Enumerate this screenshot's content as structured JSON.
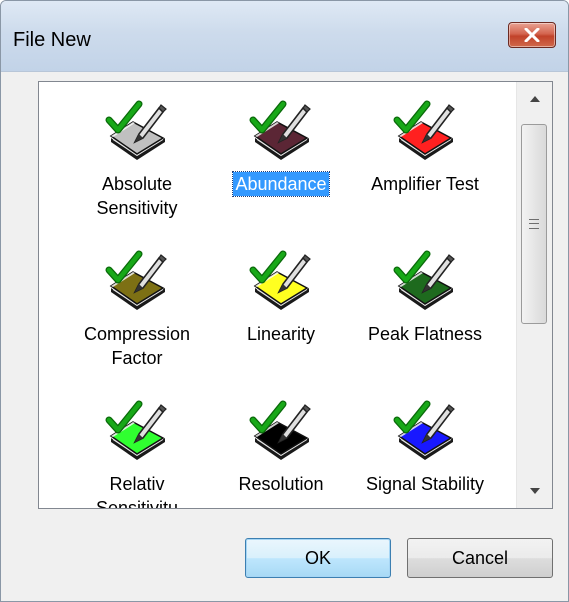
{
  "window": {
    "title": "File New",
    "close_icon": "close-icon"
  },
  "items": [
    {
      "label": "Absolute\nSensitivity",
      "color": "#c0c0c0",
      "icon": "document-check-pen-icon",
      "selected": false
    },
    {
      "label": "Abundance",
      "color": "#5b2635",
      "icon": "document-check-pen-icon",
      "selected": true
    },
    {
      "label": "Amplifier Test",
      "color": "#ff2020",
      "icon": "document-check-pen-icon",
      "selected": false
    },
    {
      "label": "Compression\nFactor",
      "color": "#7d7014",
      "icon": "document-check-pen-icon",
      "selected": false
    },
    {
      "label": "Linearity",
      "color": "#ffff20",
      "icon": "document-check-pen-icon",
      "selected": false
    },
    {
      "label": "Peak Flatness",
      "color": "#1e6a1e",
      "icon": "document-check-pen-icon",
      "selected": false
    },
    {
      "label": "Relativ\nSensitivitu",
      "color": "#30ff30",
      "icon": "document-check-pen-icon",
      "selected": false
    },
    {
      "label": "Resolution",
      "color": "#000000",
      "icon": "document-check-pen-icon",
      "selected": false
    },
    {
      "label": "Signal Stability",
      "color": "#1818ff",
      "icon": "document-check-pen-icon",
      "selected": false
    }
  ],
  "buttons": {
    "ok": "OK",
    "cancel": "Cancel"
  },
  "colors": {
    "selection": "#3399ff",
    "checkmark": "#18a818",
    "close_button": "#c1422a"
  }
}
